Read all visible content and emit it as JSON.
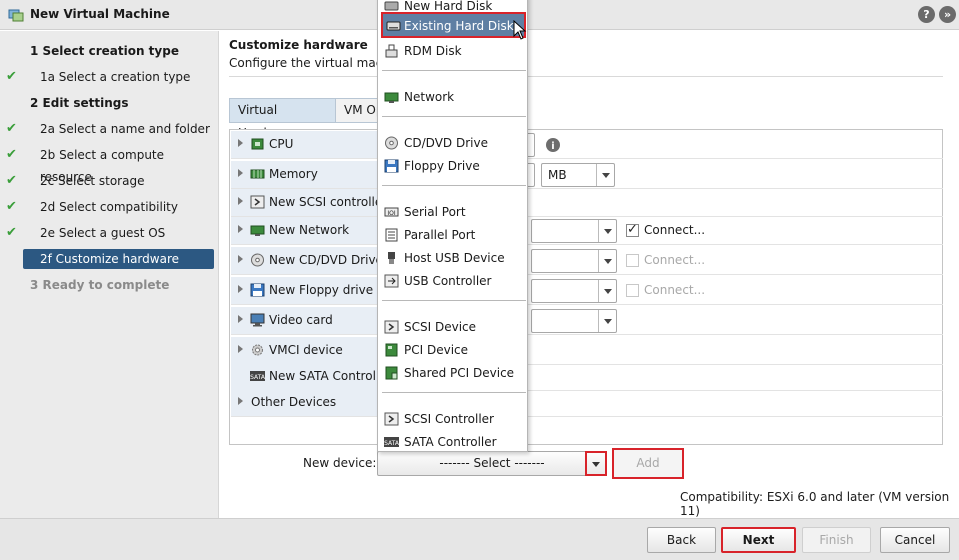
{
  "window": {
    "title": "New Virtual Machine",
    "help_icon": "?",
    "expand_icon": "»"
  },
  "steps": [
    {
      "label": "1  Select creation type",
      "state": "heading"
    },
    {
      "label": "1a  Select a creation type",
      "state": "done"
    },
    {
      "label": "2  Edit settings",
      "state": "heading"
    },
    {
      "label": "2a  Select a name and folder",
      "state": "done"
    },
    {
      "label": "2b  Select a compute resource",
      "state": "done"
    },
    {
      "label": "2c  Select storage",
      "state": "done"
    },
    {
      "label": "2d  Select compatibility",
      "state": "done"
    },
    {
      "label": "2e  Select a guest OS",
      "state": "done"
    },
    {
      "label": "2f  Customize hardware",
      "state": "active"
    },
    {
      "label": "3  Ready to complete",
      "state": "disabled"
    }
  ],
  "check_glyph": "✔",
  "main": {
    "title": "Customize hardware",
    "subtitle": "Configure the virtual machi",
    "tabs": [
      "Virtual Hardware",
      "VM Op"
    ]
  },
  "hardware": [
    {
      "name": "CPU",
      "icon": "cpu-icon"
    },
    {
      "name": "Memory",
      "icon": "memory-icon"
    },
    {
      "name": "New SCSI controller",
      "icon": "scsi-controller-icon"
    },
    {
      "name": "New Network",
      "icon": "network-icon"
    },
    {
      "name": "New CD/DVD Drive",
      "icon": "cd-dvd-icon"
    },
    {
      "name": "New Floppy drive",
      "icon": "floppy-icon"
    },
    {
      "name": "Video card",
      "icon": "video-card-icon"
    },
    {
      "name": "VMCI device",
      "icon": "vmci-icon"
    },
    {
      "name": "New SATA Controlle",
      "icon": "sata-icon"
    },
    {
      "name": "Other Devices",
      "icon": ""
    }
  ],
  "memory_unit": "MB",
  "connect_labels": [
    "Connect...",
    "Connect...",
    "Connect..."
  ],
  "info_icon": "i",
  "new_device": {
    "label": "New device:",
    "select_value": "------- Select -------",
    "add_label": "Add"
  },
  "compatibility": "Compatibility: ESXi 6.0 and later (VM version 11)",
  "footer": {
    "back": "Back",
    "next": "Next",
    "finish": "Finish",
    "cancel": "Cancel"
  },
  "menu_items": [
    {
      "label": "New Hard Disk",
      "icon": "hard-disk-icon"
    },
    {
      "label": "Existing Hard Disk",
      "icon": "hard-disk-icon",
      "selected": true
    },
    {
      "label": "RDM Disk",
      "icon": "rdm-disk-icon"
    },
    {
      "label": "Network",
      "icon": "network-icon"
    },
    {
      "label": "CD/DVD Drive",
      "icon": "cd-dvd-icon"
    },
    {
      "label": "Floppy Drive",
      "icon": "floppy-icon"
    },
    {
      "label": "Serial Port",
      "icon": "serial-port-icon"
    },
    {
      "label": "Parallel Port",
      "icon": "parallel-port-icon"
    },
    {
      "label": "Host USB Device",
      "icon": "usb-icon"
    },
    {
      "label": "USB Controller",
      "icon": "usb-controller-icon"
    },
    {
      "label": "SCSI Device",
      "icon": "scsi-device-icon"
    },
    {
      "label": "PCI Device",
      "icon": "pci-device-icon"
    },
    {
      "label": "Shared PCI Device",
      "icon": "shared-pci-icon"
    },
    {
      "label": "SCSI Controller",
      "icon": "scsi-controller-icon"
    },
    {
      "label": "SATA Controller",
      "icon": "sata-controller-icon"
    }
  ],
  "colors": {
    "active_step": "#2c5882",
    "highlight_red": "#d8232a",
    "check_green": "#3a9e3a",
    "menu_selected": "#5f7fa3"
  }
}
